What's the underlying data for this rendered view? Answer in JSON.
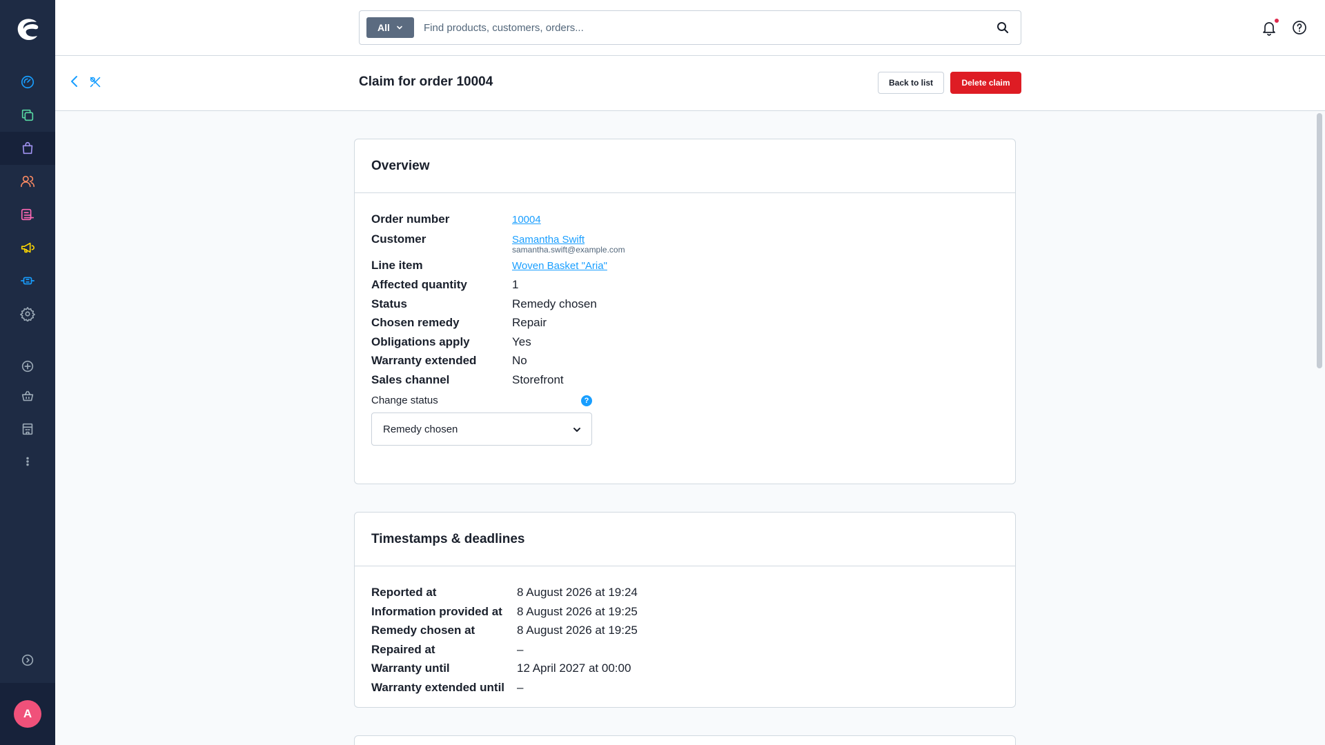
{
  "sidebar": {
    "logo": "shopware-logo",
    "avatar_initial": "A",
    "items": [
      {
        "icon": "dashboard-icon",
        "color": "#189eff"
      },
      {
        "icon": "catalog-icon",
        "color": "#57d9a3"
      },
      {
        "icon": "orders-icon",
        "color": "#a092f0"
      },
      {
        "icon": "customers-icon",
        "color": "#f88962"
      },
      {
        "icon": "content-icon",
        "color": "#ff68b4"
      },
      {
        "icon": "marketing-icon",
        "color": "#ffd700"
      },
      {
        "icon": "extensions-icon",
        "color": "#189eff"
      },
      {
        "icon": "settings-icon",
        "color": "#9aa8b5"
      },
      {
        "icon": "add-sales-channel-icon",
        "color": "#9aa8b5"
      },
      {
        "icon": "storefront-icon",
        "color": "#9aa8b5"
      },
      {
        "icon": "store-icon",
        "color": "#9aa8b5"
      },
      {
        "icon": "more-icon",
        "color": "#9aa8b5"
      },
      {
        "icon": "collapse-menu-icon",
        "color": "#9aa8b5"
      }
    ]
  },
  "search": {
    "type_label": "All",
    "placeholder": "Find products, customers, orders..."
  },
  "page": {
    "title": "Claim for order 10004",
    "back_to_list": "Back to list",
    "delete_claim": "Delete claim"
  },
  "overview": {
    "title": "Overview",
    "labels": {
      "order_number": "Order number",
      "customer": "Customer",
      "line_item": "Line item",
      "affected_quantity": "Affected quantity",
      "status": "Status",
      "chosen_remedy": "Chosen remedy",
      "obligations_apply": "Obligations apply",
      "warranty_extended": "Warranty extended",
      "sales_channel": "Sales channel"
    },
    "values": {
      "order_number": "10004",
      "customer_name": "Samantha Swift",
      "customer_email": "samantha.swift@example.com",
      "line_item": "Woven Basket \"Aria\"",
      "affected_quantity": "1",
      "status": "Remedy chosen",
      "chosen_remedy": "Repair",
      "obligations_apply": "Yes",
      "warranty_extended": "No",
      "sales_channel": "Storefront"
    },
    "change_status_label": "Change status",
    "change_status_help": "?",
    "change_status_value": "Remedy chosen"
  },
  "timestamps": {
    "title": "Timestamps & deadlines",
    "rows": [
      {
        "label": "Reported at",
        "value": "8 August 2026 at 19:24"
      },
      {
        "label": "Information provided at",
        "value": "8 August 2026 at 19:25"
      },
      {
        "label": "Remedy chosen at",
        "value": "8 August 2026 at 19:25"
      },
      {
        "label": "Repaired at",
        "value": "–"
      },
      {
        "label": "Warranty until",
        "value": "12 April 2027 at 00:00"
      },
      {
        "label": "Warranty extended until",
        "value": "–"
      }
    ]
  },
  "colors": {
    "sidebar_bg": "#1e2b44",
    "accent": "#189eff",
    "danger": "#de1c24",
    "avatar": "#f0517a"
  }
}
